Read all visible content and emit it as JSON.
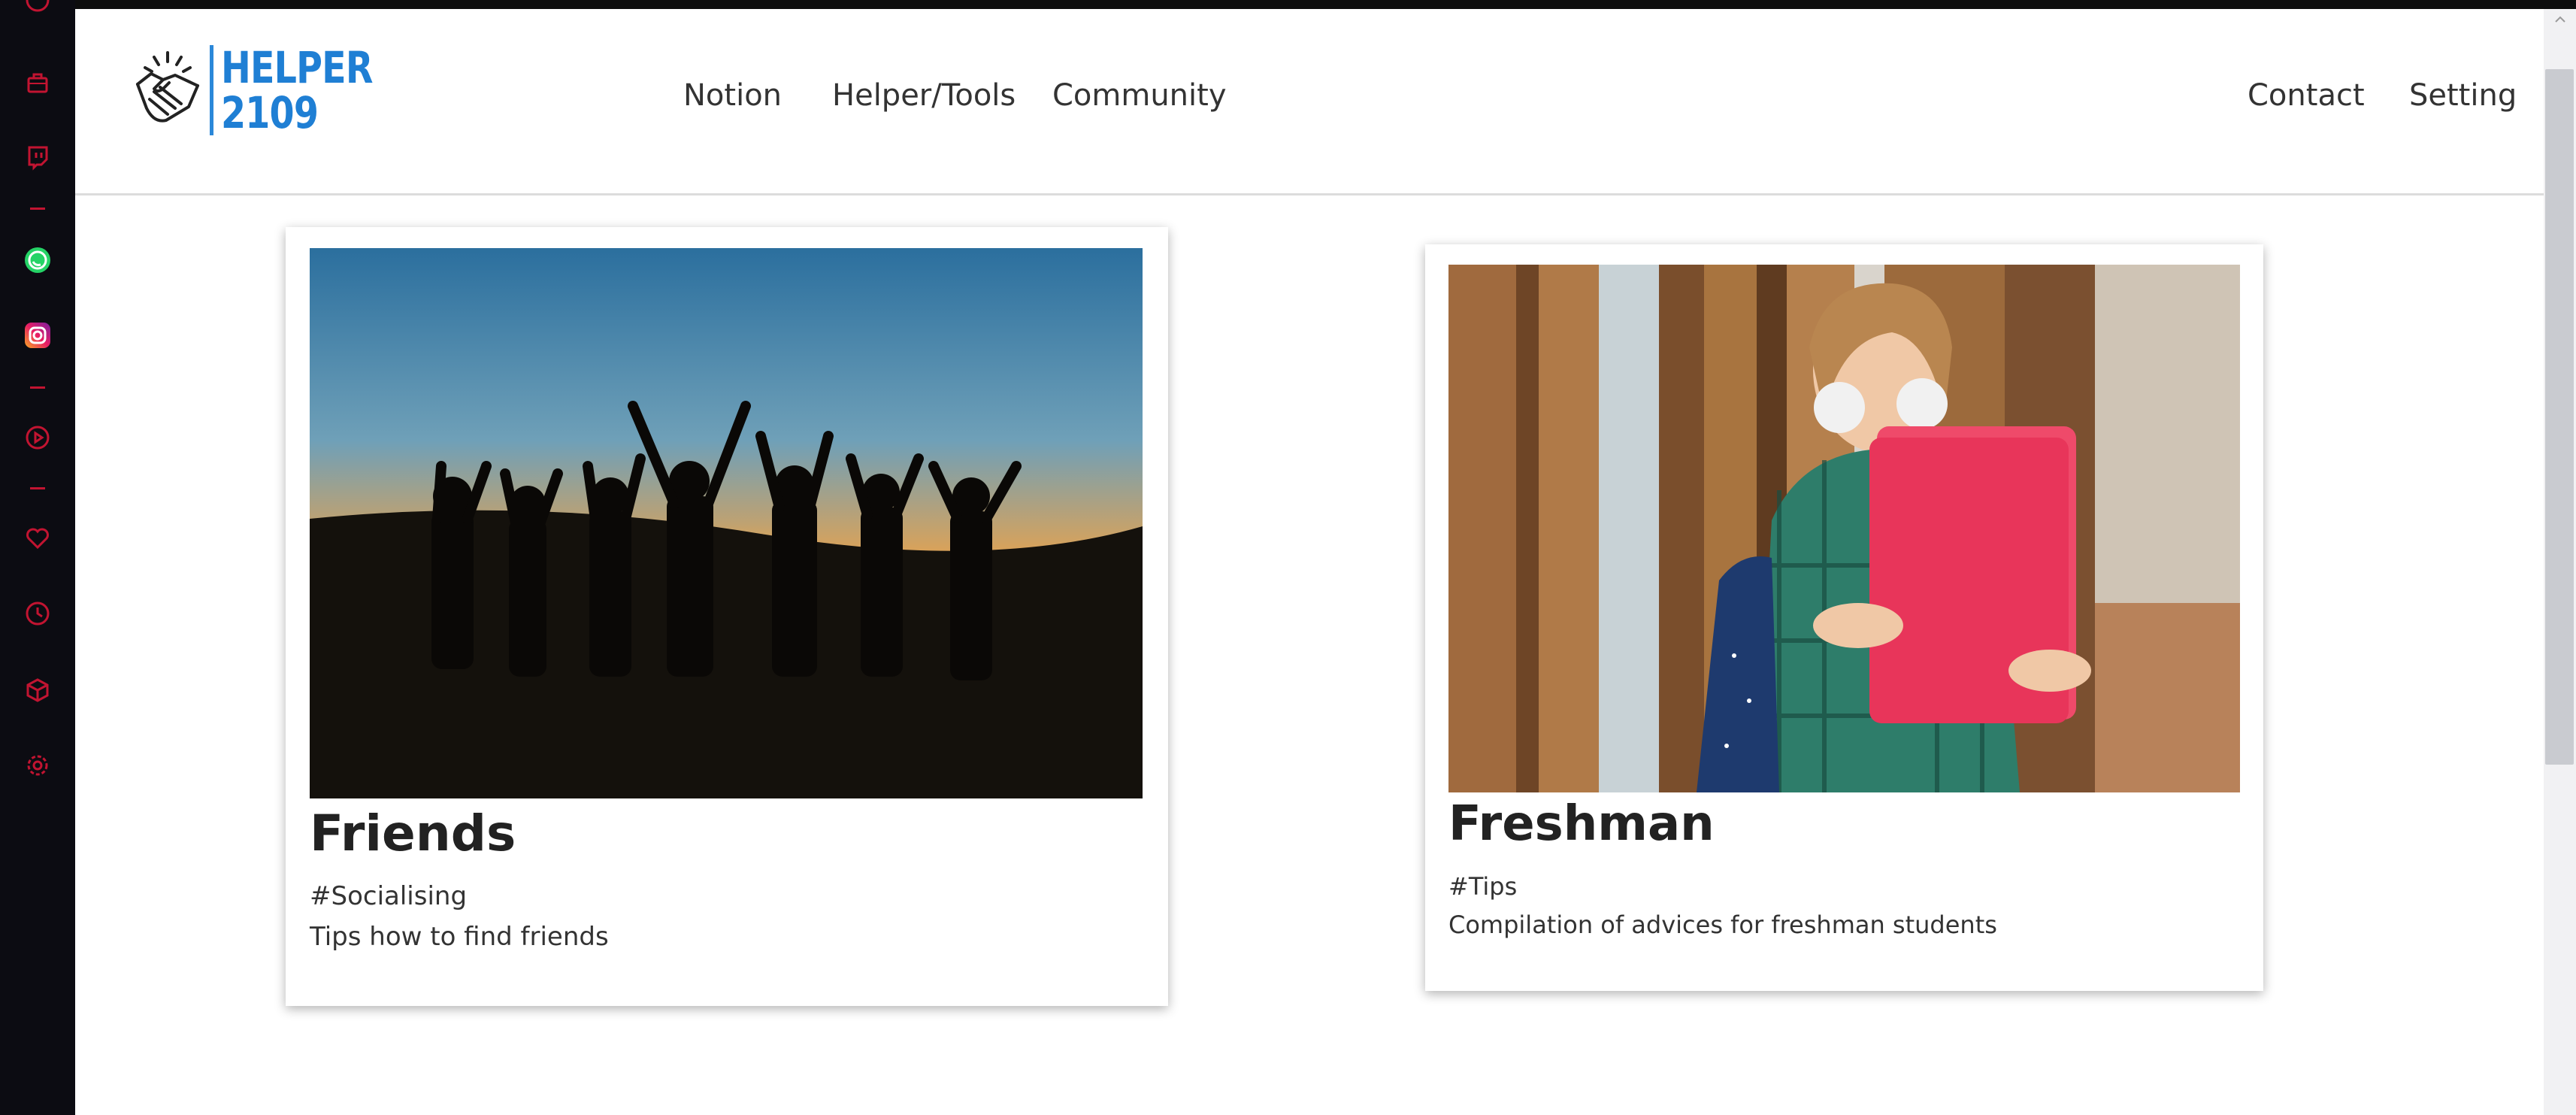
{
  "brand": {
    "line1": "HELPER",
    "line2": "2109",
    "color": "#1f7fd4"
  },
  "nav": {
    "left": [
      "Notion",
      "Helper/Tools",
      "Community"
    ],
    "right": [
      "Contact",
      "Setting"
    ]
  },
  "cards": [
    {
      "title": "Friends",
      "tag": "#Socialising",
      "description": "Tips how to find friends",
      "image_subject": "silhouettes-at-sunset"
    },
    {
      "title": "Freshman",
      "tag": "#Tips",
      "description": "Compilation of advices for freshman students",
      "image_subject": "student-holding-folder"
    }
  ],
  "sidebar_icons": [
    "briefcase-icon",
    "twitch-icon",
    "whatsapp-icon",
    "instagram-icon",
    "play-circle-icon",
    "heart-icon",
    "clock-icon",
    "cube-icon",
    "gear-icon"
  ],
  "colors": {
    "sidebar_bg": "#0c0c12",
    "sidebar_accent": "#c21431",
    "whatsapp": "#25d366",
    "instagram": "#c13584"
  }
}
